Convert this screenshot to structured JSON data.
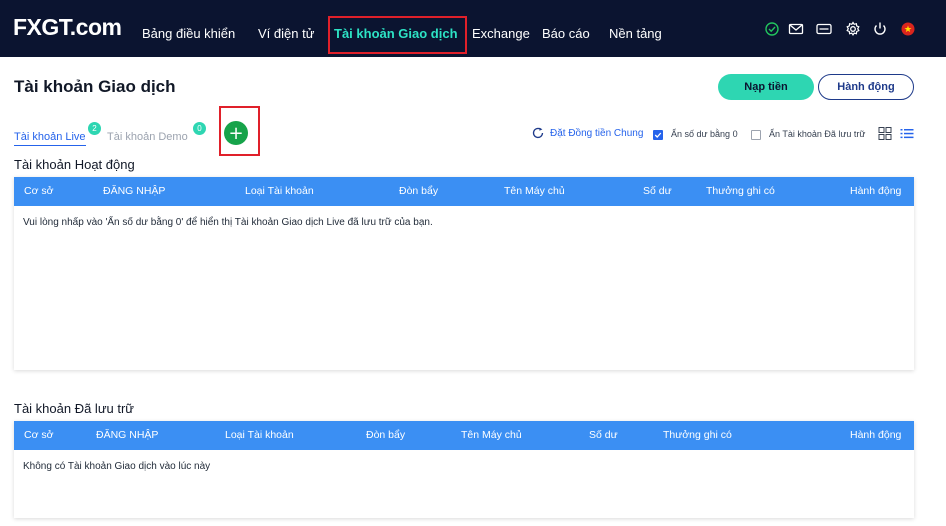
{
  "app": {
    "logo_text": "FXGT.com"
  },
  "nav": {
    "items": [
      {
        "label": "Bảng điều khiển"
      },
      {
        "label": "Ví điện tử"
      },
      {
        "label": "Tài khoản Giao dịch"
      },
      {
        "label": "Exchange"
      },
      {
        "label": "Báo cáo"
      },
      {
        "label": "Nền tảng"
      }
    ],
    "icons": [
      "verified-check-icon",
      "mail-icon",
      "card-icon",
      "gear-icon",
      "power-icon",
      "vietnam-flag-icon"
    ]
  },
  "page": {
    "title": "Tài khoản Giao dịch",
    "deposit_label": "Nạp tiền",
    "action_label": "Hành động"
  },
  "tabs": {
    "live": {
      "label": "Tài khoản Live",
      "count": "2"
    },
    "demo": {
      "label": "Tài khoản Demo",
      "count": "0"
    },
    "add_label": "+"
  },
  "options": {
    "set_currency": "Đặt Đồng tiền Chung",
    "hide_zero_balance": {
      "label": "Ẩn số dư bằng 0",
      "checked": true
    },
    "hide_archived": {
      "label": "Ẩn Tài khoản Đã lưu trữ",
      "checked": false
    }
  },
  "columns": [
    "Cơ sở",
    "ĐĂNG NHẬP",
    "Loại Tài khoản",
    "Đòn bẩy",
    "Tên Máy chủ",
    "Số dư",
    "Thưởng ghi có",
    "Hành động"
  ],
  "active_section": {
    "title": "Tài khoản Hoạt động",
    "message": "Vui lòng nhấp vào 'Ẩn số dư bằng 0' để hiển thị Tài khoản Giao dịch Live đã lưu trữ của bạn."
  },
  "archived_section": {
    "title": "Tài khoản Đã lưu trữ",
    "message": "Không có Tài khoản Giao dịch vào lúc này"
  },
  "colors": {
    "nav_bg": "#0b1430",
    "accent": "#2ed6b2",
    "table_header": "#3b8ff3",
    "highlight_box": "#e0202a"
  }
}
